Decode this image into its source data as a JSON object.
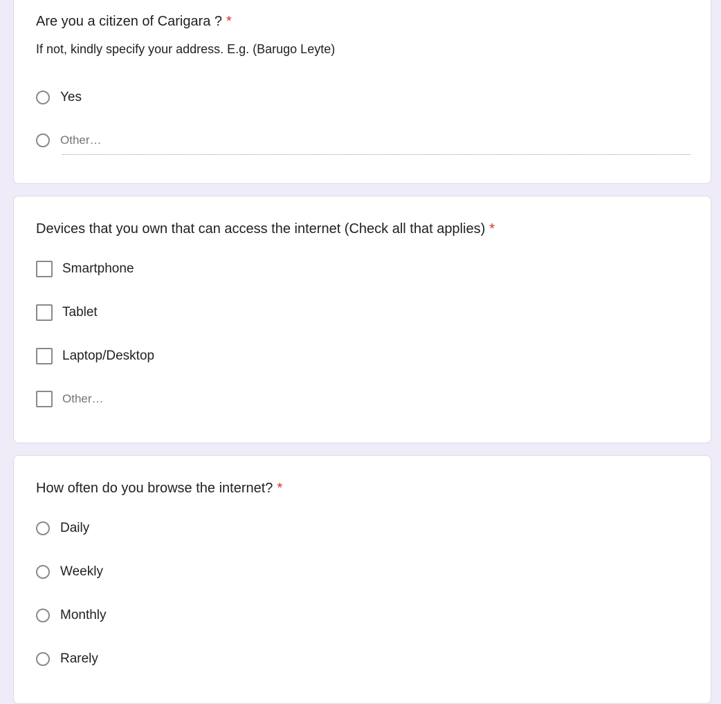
{
  "question1": {
    "title": "Are you a citizen of Carigara ?",
    "required_mark": "*",
    "description": "If not, kindly specify your address. E.g. (Barugo Leyte)",
    "options": [
      "Yes"
    ],
    "other_label": "Other…"
  },
  "question2": {
    "title": "Devices that you own that can access the internet (Check all that applies)",
    "required_mark": "*",
    "options": [
      "Smartphone",
      "Tablet",
      "Laptop/Desktop"
    ],
    "other_label": "Other…"
  },
  "question3": {
    "title": "How often do you browse the internet?",
    "required_mark": "*",
    "options": [
      "Daily",
      "Weekly",
      "Monthly",
      "Rarely"
    ]
  },
  "icons": {
    "drag_handle": "drag-handle-icon",
    "radio": "radio-button-icon",
    "checkbox": "checkbox-icon"
  },
  "colors": {
    "background": "#efebf8",
    "card": "#ffffff",
    "required": "#d93025",
    "text": "#202124"
  }
}
